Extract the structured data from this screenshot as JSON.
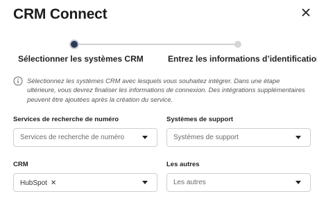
{
  "dialog": {
    "title": "CRM Connect",
    "close_icon": "close-icon"
  },
  "stepper": {
    "steps": [
      {
        "label": "Sélectionner les systèmes CRM",
        "active": true
      },
      {
        "label": "Entrez les informations d’identification",
        "active": false
      }
    ]
  },
  "info": {
    "icon": "info-icon",
    "text": "Sélectionnez les systèmes CRM avec lesquels vous souhaitez intégrer. Dans une étape ultérieure, vous devrez finaliser les informations de connexion. Des intégrations supplémentaires peuvent être ajoutées après la création du service."
  },
  "fields": {
    "number_lookup": {
      "label": "Services de recherche de numéro",
      "placeholder": "Services de recherche de numéro"
    },
    "support": {
      "label": "Systèmes de support",
      "placeholder": "Systèmes de support"
    },
    "crm": {
      "label": "CRM",
      "selected": [
        "HubSpot"
      ],
      "remove_symbol": "✕"
    },
    "others": {
      "label": "Les autres",
      "placeholder": "Les autres"
    }
  },
  "colors": {
    "active_step": "#2e3a55",
    "inactive_step": "#d5d5d5"
  }
}
